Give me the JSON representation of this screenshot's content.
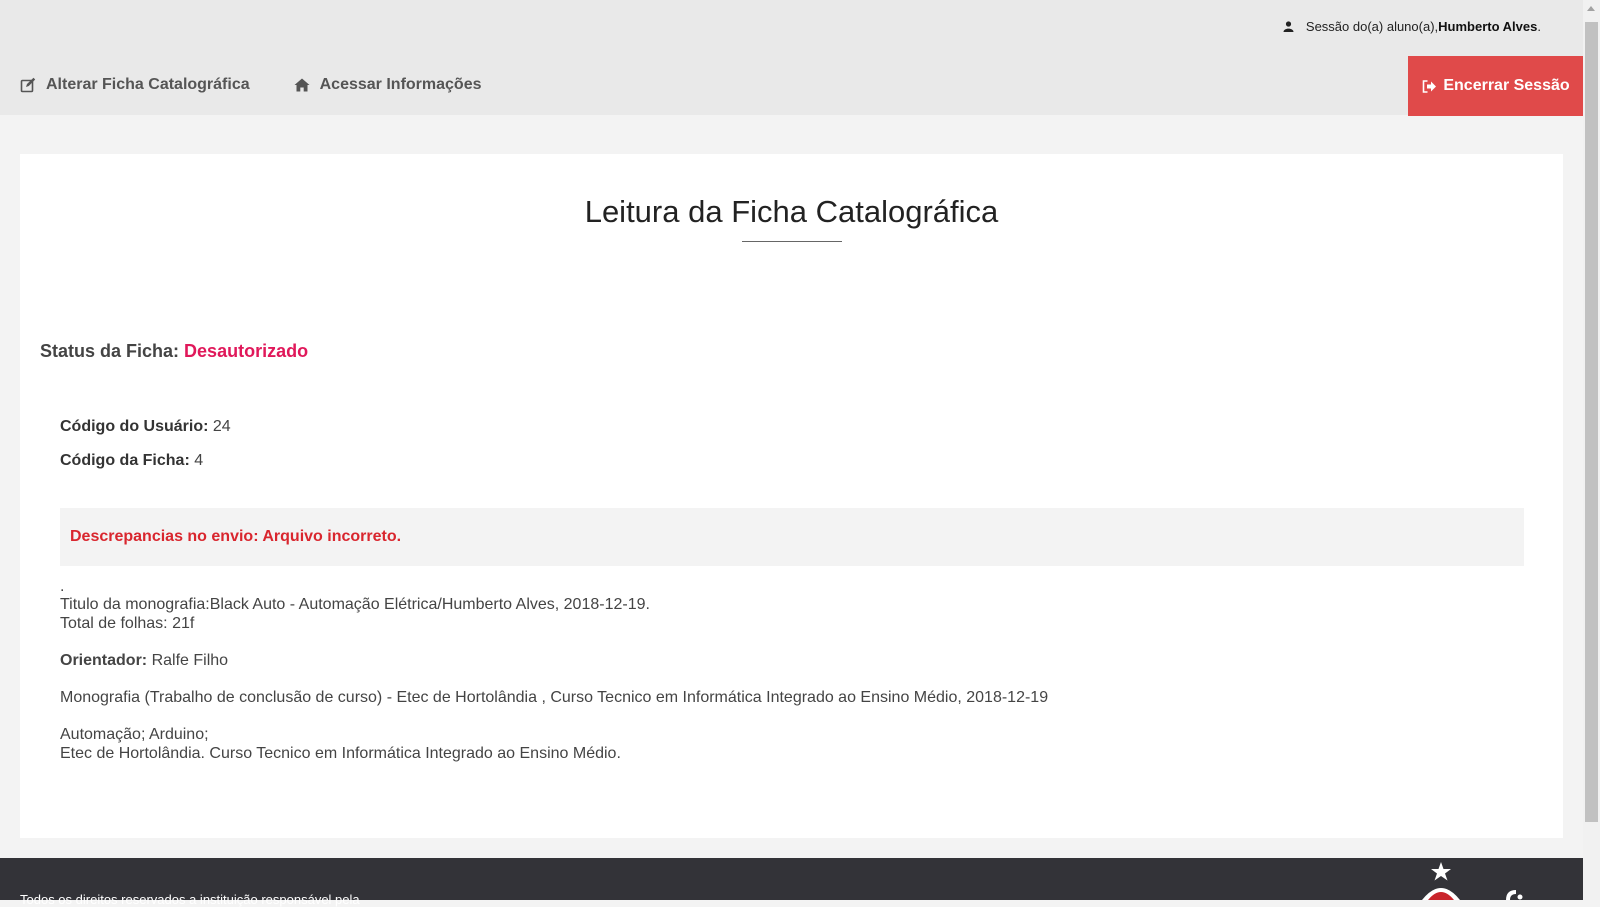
{
  "header": {
    "session_prefix": "Sessão do(a) aluno(a), ",
    "session_user": "Humberto Alves",
    "session_suffix": ".",
    "nav": [
      {
        "label": "Alterar Ficha Catalográfica",
        "icon": "edit-icon"
      },
      {
        "label": "Acessar Informações",
        "icon": "home-icon"
      }
    ],
    "logout_label": "Encerrar Sessão",
    "logout_icon": "sign-out-icon",
    "logout_color": "#e04a4a"
  },
  "main": {
    "title": "Leitura da Ficha Catalográfica",
    "status_label": "Status da Ficha:",
    "status_value": "Desautorizado",
    "status_color": "#e0185a",
    "user_code_label": "Código do Usuário:",
    "user_code_value": "24",
    "form_code_label": "Código da Ficha:",
    "form_code_value": "4",
    "alert": "Descrepancias no envio: Arquivo incorreto.",
    "dot": ".",
    "title_line": "Titulo da monografia:Black Auto - Automação Elétrica/Humberto Alves, 2018-12-19.",
    "pages_line": "Total de folhas: 21f",
    "advisor_label": "Orientador:",
    "advisor_value": "Ralfe Filho",
    "monograph_line": "Monografia (Trabalho de conclusão de curso) - Etec de Hortolândia , Curso Tecnico em Informática Integrado ao Ensino Médio, 2018-12-19",
    "keywords_line": "Automação; Arduino;",
    "institution_line": "Etec de Hortolândia. Curso Tecnico em Informática Integrado ao Ensino Médio."
  },
  "footer": {
    "text": "Todos os direitos reservados a instituição responsável pela"
  }
}
